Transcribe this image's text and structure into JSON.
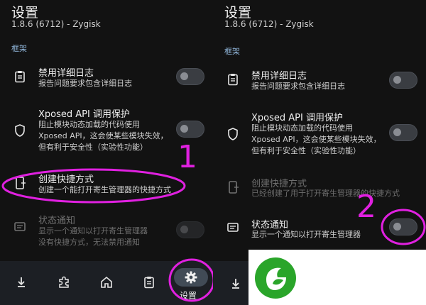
{
  "screen": {
    "title": "设置",
    "version": "1.8.6 (6712) - Zygisk",
    "section": "框架"
  },
  "left": {
    "items": [
      {
        "title": "禁用详细日志",
        "sub1": "报告问题要求包含详细日志",
        "sub2": "",
        "sub3": ""
      },
      {
        "title": "Xposed API 调用保护",
        "sub1": "阻止模块动态加载的代码使用",
        "sub2": "Xposed API，这会使某些模块失效，",
        "sub3": "但有利于安全性（实验性功能）"
      },
      {
        "title": "创建快捷方式",
        "sub1": "创建一个能打开寄生管理器的快捷方式",
        "sub2": "",
        "sub3": ""
      },
      {
        "title": "状态通知",
        "sub1": "显示一个通知以打开寄生管理器",
        "sub2": "没有快捷方式，无法禁用通知",
        "sub3": ""
      }
    ]
  },
  "right": {
    "items": [
      {
        "title": "禁用详细日志",
        "sub1": "报告问题要求包含详细日志",
        "sub2": "",
        "sub3": ""
      },
      {
        "title": "Xposed API 调用保护",
        "sub1": "阻止模块动态加载的代码使用",
        "sub2": "Xposed API，这会使某些模块失效，",
        "sub3": "但有利于安全性（实验性功能）"
      },
      {
        "title": "创建快捷方式",
        "sub1": "已经创建了用于打开寄生管理器的快捷方式",
        "sub2": "",
        "sub3": ""
      },
      {
        "title": "状态通知",
        "sub1": "显示一个通知以打开寄生管理器",
        "sub2": "",
        "sub3": ""
      }
    ]
  },
  "nav": {
    "items": [
      "download-icon",
      "extension-icon",
      "home-icon",
      "logs-icon",
      "settings-icon"
    ],
    "active_label": "设置"
  },
  "annotations": {
    "mark1": "1",
    "mark2": "2",
    "color": "#e020e0"
  },
  "colors": {
    "background": "#121212",
    "navbar": "#1c1f24",
    "section": "#8fb4d8",
    "logo_green": "#2aa52a"
  }
}
